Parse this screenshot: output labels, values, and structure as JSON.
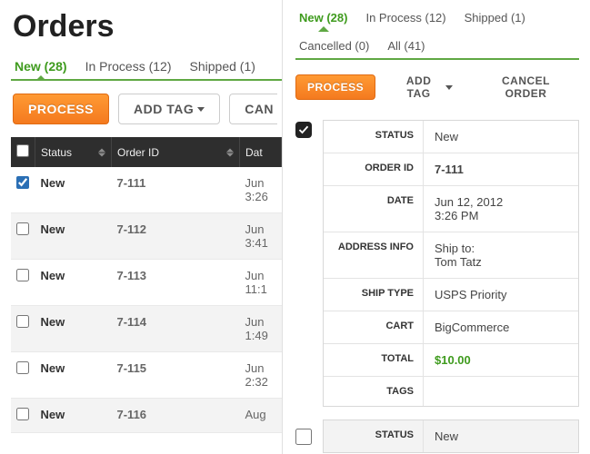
{
  "title": "Orders",
  "tabsLeft": [
    {
      "label": "New (28)",
      "active": true
    },
    {
      "label": "In Process (12)"
    },
    {
      "label": "Shipped (1)"
    }
  ],
  "tabsRight": [
    {
      "label": "New (28)",
      "active": true
    },
    {
      "label": "In Process (12)"
    },
    {
      "label": "Shipped (1)"
    },
    {
      "label": "Cancelled (0)"
    },
    {
      "label": "All (41)"
    }
  ],
  "toolbar": {
    "process": "PROCESS",
    "addTag": "ADD TAG",
    "cancel": "CANCEL ORDER",
    "cancelShort": "CAN"
  },
  "cols": {
    "status": "Status",
    "orderId": "Order ID",
    "date": "Dat"
  },
  "rows": [
    {
      "checked": true,
      "status": "New",
      "id": "7-111",
      "d1": "Jun",
      "d2": "3:26"
    },
    {
      "checked": false,
      "status": "New",
      "id": "7-112",
      "d1": "Jun",
      "d2": "3:41"
    },
    {
      "checked": false,
      "status": "New",
      "id": "7-113",
      "d1": "Jun",
      "d2": "11:1"
    },
    {
      "checked": false,
      "status": "New",
      "id": "7-114",
      "d1": "Jun",
      "d2": "1:49"
    },
    {
      "checked": false,
      "status": "New",
      "id": "7-115",
      "d1": "Jun",
      "d2": "2:32"
    },
    {
      "checked": false,
      "status": "New",
      "id": "7-116",
      "d1": "Aug",
      "d2": ""
    }
  ],
  "detail": {
    "labels": {
      "status": "STATUS",
      "orderId": "ORDER ID",
      "date": "DATE",
      "addr": "ADDRESS INFO",
      "ship": "SHIP TYPE",
      "cart": "CART",
      "total": "TOTAL",
      "tags": "TAGS"
    },
    "status": "New",
    "orderId": "7-111",
    "date1": "Jun 12, 2012",
    "date2": "3:26 PM",
    "addr1": "Ship to:",
    "addr2": "Tom Tatz",
    "ship": "USPS Priority",
    "cart": "BigCommerce",
    "total": "$10.00",
    "tags": ""
  },
  "detail2": {
    "status": "New"
  }
}
